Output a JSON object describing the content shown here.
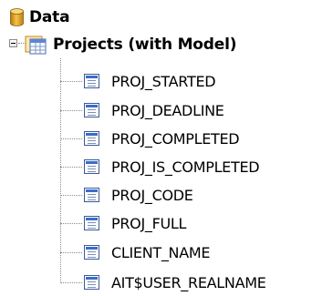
{
  "tree": {
    "root": {
      "label": "Data",
      "icon": "database-icon"
    },
    "table": {
      "label": "Projects (with Model)",
      "icon": "table-icon",
      "expanded": true
    },
    "fields": [
      {
        "label": "PROJ_STARTED"
      },
      {
        "label": "PROJ_DEADLINE"
      },
      {
        "label": "PROJ_COMPLETED"
      },
      {
        "label": "PROJ_IS_COMPLETED"
      },
      {
        "label": "PROJ_CODE"
      },
      {
        "label": "PROJ_FULL"
      },
      {
        "label": "CLIENT_NAME"
      },
      {
        "label": "AIT$USER_REALNAME"
      }
    ]
  },
  "colors": {
    "db_gold": "#e0a020",
    "field_blue": "#3c6cc8",
    "connector": "#8c8c8c"
  }
}
